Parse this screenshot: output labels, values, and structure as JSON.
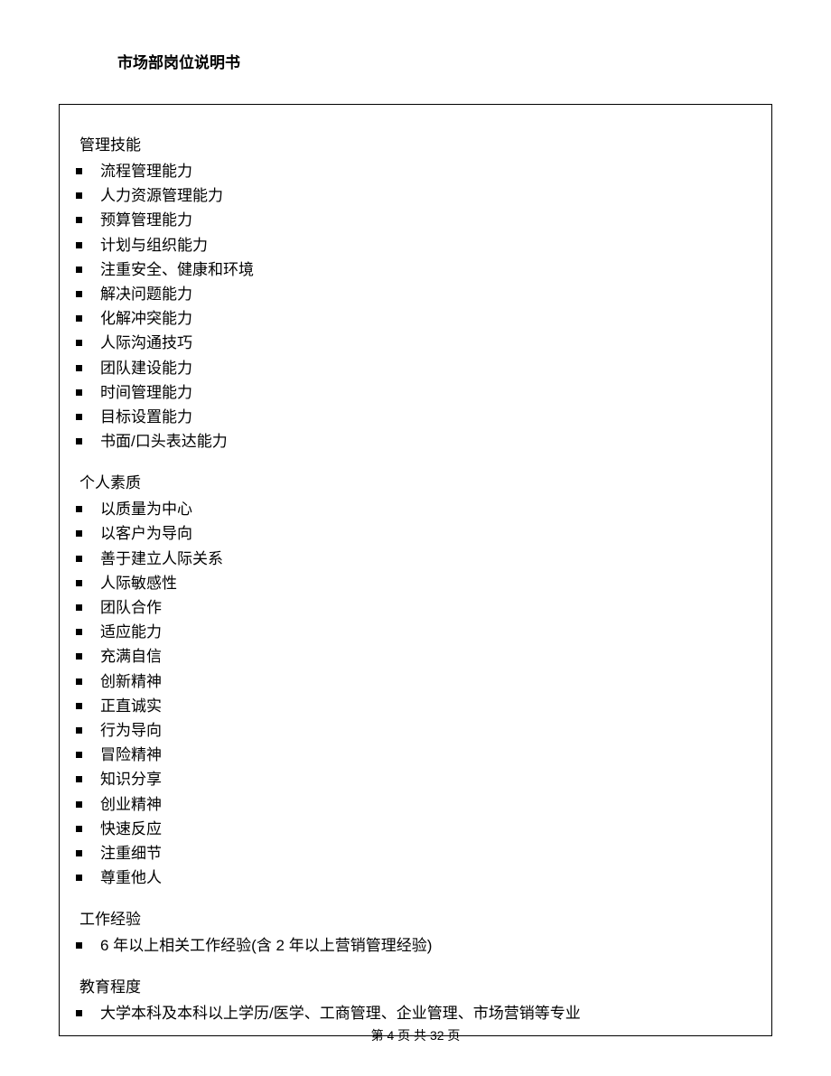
{
  "header": {
    "title": "市场部岗位说明书"
  },
  "sections": [
    {
      "heading": "管理技能",
      "items": [
        "流程管理能力",
        "人力资源管理能力",
        "预算管理能力",
        "计划与组织能力",
        "注重安全、健康和环境",
        "解决问题能力",
        "化解冲突能力",
        "人际沟通技巧",
        "团队建设能力",
        "时间管理能力",
        "目标设置能力",
        "书面/口头表达能力"
      ]
    },
    {
      "heading": "个人素质",
      "items": [
        "以质量为中心",
        "以客户为导向",
        "善于建立人际关系",
        "人际敏感性",
        "团队合作",
        "适应能力",
        "充满自信",
        "创新精神",
        "正直诚实",
        "行为导向",
        "冒险精神",
        "知识分享",
        "创业精神",
        "快速反应",
        "注重细节",
        "尊重他人"
      ]
    },
    {
      "heading": "工作经验",
      "items": [
        "6 年以上相关工作经验(含 2 年以上营销管理经验)"
      ]
    },
    {
      "heading": "教育程度",
      "items": [
        "大学本科及本科以上学历/医学、工商管理、企业管理、市场营销等专业"
      ]
    }
  ],
  "footer": {
    "text": "第 4 页 共 32 页"
  }
}
